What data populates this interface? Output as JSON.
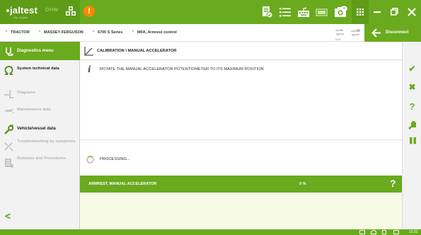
{
  "topbar": {
    "logo": "jaltest",
    "logo_sub": "by cojali",
    "product": "OHW",
    "alert_glyph": "!",
    "help_glyph": "?",
    "icons": [
      "report-icon",
      "list-icon",
      "keyboard-icon",
      "battery-icon",
      "camera-icon",
      "help-icon",
      "apps-grid-icon",
      "minimize-icon",
      "restore-icon",
      "close-icon"
    ]
  },
  "breadcrumb": {
    "items": [
      "TRACTOR",
      "MASSEY FERGUSON",
      "6700 S Series",
      "MFA, Armrest control"
    ],
    "separator": ">",
    "test_label": "TEST",
    "disconnect_label": "Disconnect"
  },
  "sidebar": {
    "header": "Diagnostics menu",
    "items": [
      {
        "label": "System technical data",
        "icon": "omega-icon",
        "enabled": true
      },
      {
        "label": "Diagrams",
        "icon": "diagram-icon",
        "enabled": false
      },
      {
        "label": "Maintenance data",
        "icon": "oil-can-icon",
        "enabled": false
      },
      {
        "label": "Vehicle/vessel data",
        "icon": "wrench-icon",
        "enabled": true
      },
      {
        "label": "Troubleshooting by symptoms",
        "icon": "tools-icon",
        "enabled": false
      },
      {
        "label": "Releases and Procedures",
        "icon": "document-icon",
        "enabled": false
      }
    ],
    "back_glyph": "<"
  },
  "main": {
    "title": "CALIBRATION \\ MANUAL ACCELERATOR",
    "instruction": "ROTATE THE MANUAL ACCELERATOR POTENTIOMETER TO ITS MAXIMUM POSITION",
    "info_glyph": "i",
    "processing": "PROCESSING...",
    "parameter": {
      "label": "ARMREST, MANUAL ACCELERATOR",
      "value": "0 %",
      "help_glyph": "?"
    }
  },
  "actions": [
    {
      "name": "accept-icon",
      "glyph": "✔"
    },
    {
      "name": "cancel-icon",
      "glyph": "✖"
    },
    {
      "name": "help-icon",
      "glyph": "?"
    },
    {
      "name": "tools-icon",
      "glyph": ""
    },
    {
      "name": "pause-icon",
      "glyph": "❚❚"
    }
  ],
  "statusbar": {
    "clock": "13:22"
  },
  "colors": {
    "accent": "#6aaa1e",
    "accent_dark": "#5e9c18",
    "alert": "#f28a00",
    "panel": "#f7fbe6"
  }
}
